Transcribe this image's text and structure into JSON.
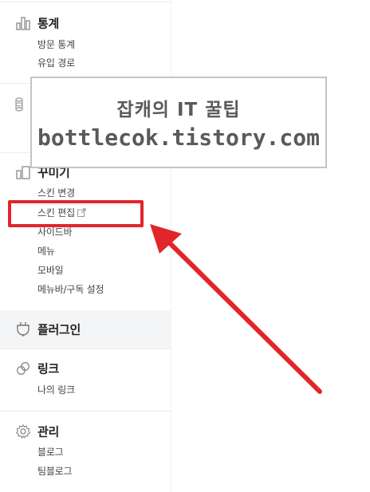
{
  "sidebar": {
    "sections": [
      {
        "title": "통계",
        "icon": "bar-chart-icon",
        "items": [
          "방문 통계",
          "유입 경로"
        ]
      },
      {
        "title": "꾸미기",
        "icon": "decorate-icon",
        "items": [
          "스킨 변경",
          "스킨 편집",
          "사이드바",
          "메뉴",
          "모바일",
          "메뉴바/구독 설정"
        ]
      },
      {
        "title": "플러그인",
        "icon": "plugin-icon",
        "items": []
      },
      {
        "title": "링크",
        "icon": "link-icon",
        "items": [
          "나의 링크"
        ]
      },
      {
        "title": "관리",
        "icon": "gear-icon",
        "items": [
          "블로그",
          "팀블로그"
        ]
      }
    ],
    "partial_title": "꾸미기"
  },
  "watermark": {
    "line1": "잡캐의 IT 꿀팁",
    "line2": "bottlecok.tistory.com"
  },
  "colors": {
    "highlight": "#e0262b",
    "active_bg": "#f4f5f6"
  }
}
